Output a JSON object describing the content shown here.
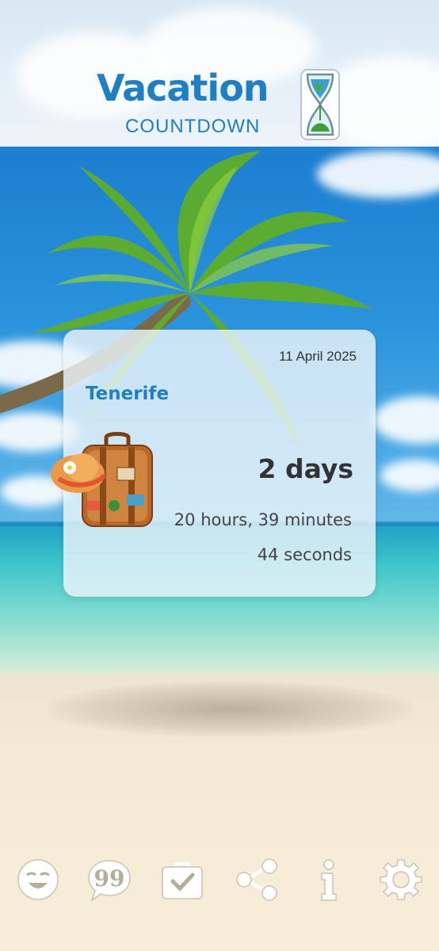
{
  "app": {
    "logo_title": "Vacation",
    "logo_subtitle": "COUNTDOWN"
  },
  "countdown": {
    "date": "11 April 2025",
    "destination": "Tenerife",
    "days": "2 days",
    "hours_minutes": "20 hours, 39 minutes",
    "seconds": "44 seconds"
  },
  "toolbar": {
    "items": [
      {
        "icon": "smiley-icon"
      },
      {
        "icon": "quote-bubble-icon"
      },
      {
        "icon": "checklist-suitcase-icon"
      },
      {
        "icon": "share-icon"
      },
      {
        "icon": "info-icon"
      },
      {
        "icon": "gear-icon"
      }
    ]
  },
  "colors": {
    "brand": "#1f7fc2",
    "card_bg": "#ecf4fa",
    "text_dark": "#333333"
  }
}
